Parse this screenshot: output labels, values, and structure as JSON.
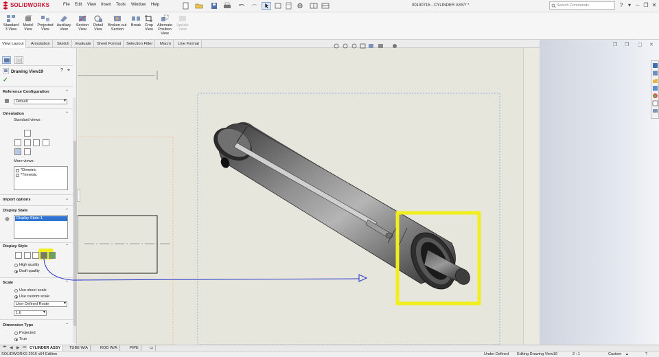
{
  "app": {
    "brand": "SOLIDWORKS",
    "title": "00130715 - CYLINDER ASSY *"
  },
  "menu": [
    "File",
    "Edit",
    "View",
    "Insert",
    "Tools",
    "Window",
    "Help"
  ],
  "search": {
    "placeholder": "Search Commands"
  },
  "ribbon": [
    {
      "label": "Standard 3 View"
    },
    {
      "label": "Model View"
    },
    {
      "label": "Projected View"
    },
    {
      "label": "Auxiliary View"
    },
    {
      "label": "Section View"
    },
    {
      "label": "Detail View"
    },
    {
      "label": "Broken-out Section"
    },
    {
      "label": "Break"
    },
    {
      "label": "Crop View"
    },
    {
      "label": "Alternate Position View"
    },
    {
      "label": "Update View"
    }
  ],
  "tabs": [
    "View Layout",
    "Annotation",
    "Sketch",
    "Evaluate",
    "Sheet Format",
    "Selection Filter",
    "Macro",
    "Line Format"
  ],
  "property_manager": {
    "title": "Drawing View19",
    "reference_configuration": {
      "label": "Reference Configuration",
      "value": "Default"
    },
    "orientation": {
      "label": "Orientation",
      "standard_views": "Standard views:",
      "more_views": "More views:",
      "more_views_items": [
        "*Dimetric",
        "*Trimetric"
      ]
    },
    "import_options": "Import options",
    "display_state": {
      "label": "Display State",
      "item": "Display State-1"
    },
    "display_style": {
      "label": "Display Style",
      "high_quality": "High quality",
      "draft_quality": "Draft quality"
    },
    "scale": {
      "label": "Scale",
      "use_sheet": "Use sheet scale",
      "use_custom": "Use custom scale",
      "custom_value": "User Defined Route",
      "ratio": "1:6"
    },
    "dimension_type": {
      "label": "Dimension Type",
      "projected": "Projected",
      "true": "True"
    }
  },
  "sheet_tabs": [
    "CYLINDER ASSY",
    "TUBE W/A",
    "ROD W/A",
    "PIPE"
  ],
  "status": {
    "edition": "SOLIDWORKS 2016 x64 Edition",
    "defined": "Under Defined",
    "editing": "Editing Drawing View19",
    "scale": "2 : 1",
    "units": "Custom"
  },
  "colors": {
    "highlight": "#f0ee1c",
    "annotation_line": "#2233cc",
    "brand": "#c8102e"
  }
}
